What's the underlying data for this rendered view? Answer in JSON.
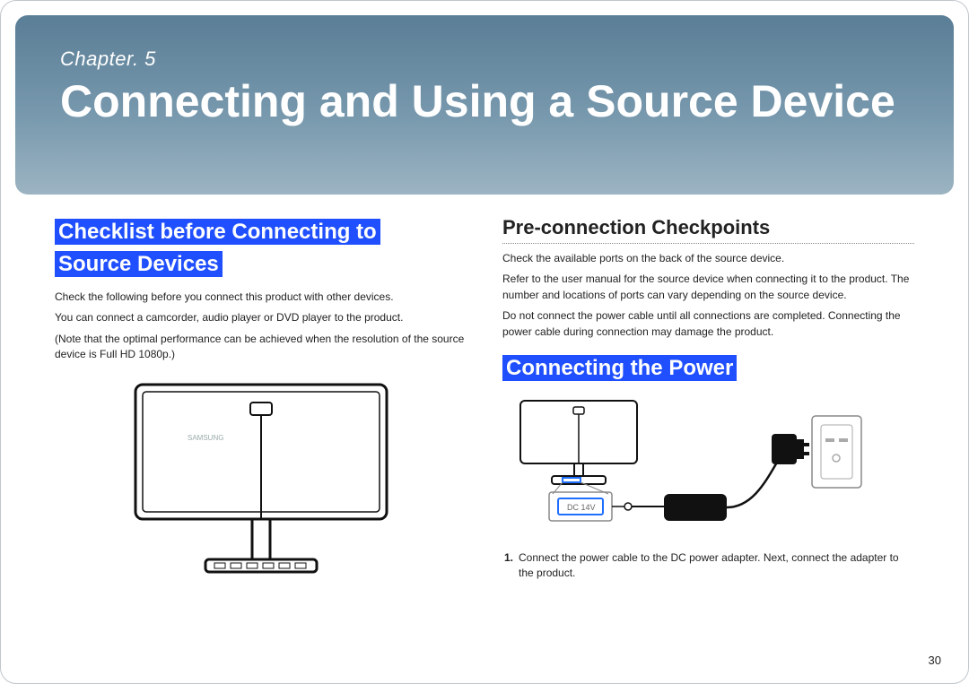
{
  "hero": {
    "chapter_label": "Chapter. 5",
    "title": "Connecting and Using a Source Device"
  },
  "left": {
    "heading_line1": "Checklist before Connecting to",
    "heading_line2": "Source Devices",
    "p1": "Check the following before you connect this product with other devices.",
    "p2": "You can connect a camcorder, audio player or DVD player to the product.",
    "p3": "(Note that the optimal performance can be achieved when the resolution of the source device is Full HD 1080p.)"
  },
  "right": {
    "sub1": "Pre-connection Checkpoints",
    "sub1_p1": "Check the available ports on the back of the source device.",
    "sub1_p2": "Refer to the user manual for the source device when connecting it to the product. The number and locations of ports can vary depending on the source device.",
    "sub1_p3": "Do not connect the power cable until all connections are completed. Connecting the power cable during connection may damage the product.",
    "sub2": "Connecting the Power",
    "dc_label": "DC 14V",
    "step1_num": "1.",
    "step1_text": "Connect the power cable to the DC power adapter. Next, connect the adapter to the product."
  },
  "page_number": "30"
}
